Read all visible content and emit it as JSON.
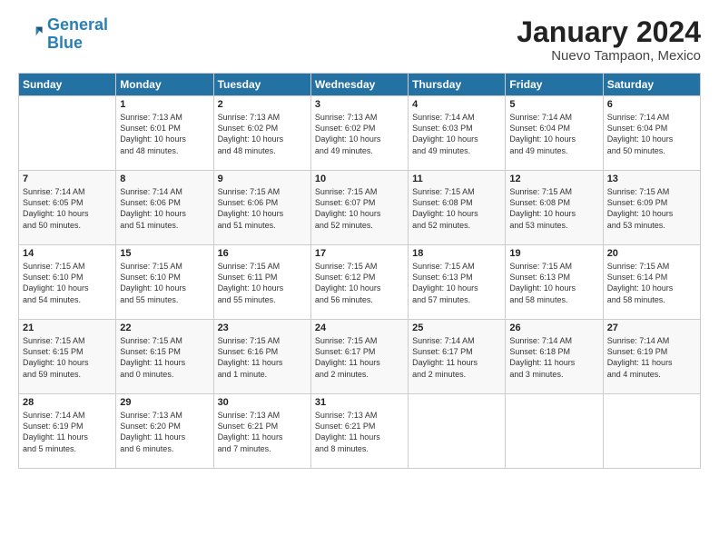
{
  "logo": {
    "line1": "General",
    "line2": "Blue"
  },
  "title": "January 2024",
  "subtitle": "Nuevo Tampaon, Mexico",
  "days_header": [
    "Sunday",
    "Monday",
    "Tuesday",
    "Wednesday",
    "Thursday",
    "Friday",
    "Saturday"
  ],
  "weeks": [
    [
      {
        "day": "",
        "content": ""
      },
      {
        "day": "1",
        "content": "Sunrise: 7:13 AM\nSunset: 6:01 PM\nDaylight: 10 hours\nand 48 minutes."
      },
      {
        "day": "2",
        "content": "Sunrise: 7:13 AM\nSunset: 6:02 PM\nDaylight: 10 hours\nand 48 minutes."
      },
      {
        "day": "3",
        "content": "Sunrise: 7:13 AM\nSunset: 6:02 PM\nDaylight: 10 hours\nand 49 minutes."
      },
      {
        "day": "4",
        "content": "Sunrise: 7:14 AM\nSunset: 6:03 PM\nDaylight: 10 hours\nand 49 minutes."
      },
      {
        "day": "5",
        "content": "Sunrise: 7:14 AM\nSunset: 6:04 PM\nDaylight: 10 hours\nand 49 minutes."
      },
      {
        "day": "6",
        "content": "Sunrise: 7:14 AM\nSunset: 6:04 PM\nDaylight: 10 hours\nand 50 minutes."
      }
    ],
    [
      {
        "day": "7",
        "content": "Sunrise: 7:14 AM\nSunset: 6:05 PM\nDaylight: 10 hours\nand 50 minutes."
      },
      {
        "day": "8",
        "content": "Sunrise: 7:14 AM\nSunset: 6:06 PM\nDaylight: 10 hours\nand 51 minutes."
      },
      {
        "day": "9",
        "content": "Sunrise: 7:15 AM\nSunset: 6:06 PM\nDaylight: 10 hours\nand 51 minutes."
      },
      {
        "day": "10",
        "content": "Sunrise: 7:15 AM\nSunset: 6:07 PM\nDaylight: 10 hours\nand 52 minutes."
      },
      {
        "day": "11",
        "content": "Sunrise: 7:15 AM\nSunset: 6:08 PM\nDaylight: 10 hours\nand 52 minutes."
      },
      {
        "day": "12",
        "content": "Sunrise: 7:15 AM\nSunset: 6:08 PM\nDaylight: 10 hours\nand 53 minutes."
      },
      {
        "day": "13",
        "content": "Sunrise: 7:15 AM\nSunset: 6:09 PM\nDaylight: 10 hours\nand 53 minutes."
      }
    ],
    [
      {
        "day": "14",
        "content": "Sunrise: 7:15 AM\nSunset: 6:10 PM\nDaylight: 10 hours\nand 54 minutes."
      },
      {
        "day": "15",
        "content": "Sunrise: 7:15 AM\nSunset: 6:10 PM\nDaylight: 10 hours\nand 55 minutes."
      },
      {
        "day": "16",
        "content": "Sunrise: 7:15 AM\nSunset: 6:11 PM\nDaylight: 10 hours\nand 55 minutes."
      },
      {
        "day": "17",
        "content": "Sunrise: 7:15 AM\nSunset: 6:12 PM\nDaylight: 10 hours\nand 56 minutes."
      },
      {
        "day": "18",
        "content": "Sunrise: 7:15 AM\nSunset: 6:13 PM\nDaylight: 10 hours\nand 57 minutes."
      },
      {
        "day": "19",
        "content": "Sunrise: 7:15 AM\nSunset: 6:13 PM\nDaylight: 10 hours\nand 58 minutes."
      },
      {
        "day": "20",
        "content": "Sunrise: 7:15 AM\nSunset: 6:14 PM\nDaylight: 10 hours\nand 58 minutes."
      }
    ],
    [
      {
        "day": "21",
        "content": "Sunrise: 7:15 AM\nSunset: 6:15 PM\nDaylight: 10 hours\nand 59 minutes."
      },
      {
        "day": "22",
        "content": "Sunrise: 7:15 AM\nSunset: 6:15 PM\nDaylight: 11 hours\nand 0 minutes."
      },
      {
        "day": "23",
        "content": "Sunrise: 7:15 AM\nSunset: 6:16 PM\nDaylight: 11 hours\nand 1 minute."
      },
      {
        "day": "24",
        "content": "Sunrise: 7:15 AM\nSunset: 6:17 PM\nDaylight: 11 hours\nand 2 minutes."
      },
      {
        "day": "25",
        "content": "Sunrise: 7:14 AM\nSunset: 6:17 PM\nDaylight: 11 hours\nand 2 minutes."
      },
      {
        "day": "26",
        "content": "Sunrise: 7:14 AM\nSunset: 6:18 PM\nDaylight: 11 hours\nand 3 minutes."
      },
      {
        "day": "27",
        "content": "Sunrise: 7:14 AM\nSunset: 6:19 PM\nDaylight: 11 hours\nand 4 minutes."
      }
    ],
    [
      {
        "day": "28",
        "content": "Sunrise: 7:14 AM\nSunset: 6:19 PM\nDaylight: 11 hours\nand 5 minutes."
      },
      {
        "day": "29",
        "content": "Sunrise: 7:13 AM\nSunset: 6:20 PM\nDaylight: 11 hours\nand 6 minutes."
      },
      {
        "day": "30",
        "content": "Sunrise: 7:13 AM\nSunset: 6:21 PM\nDaylight: 11 hours\nand 7 minutes."
      },
      {
        "day": "31",
        "content": "Sunrise: 7:13 AM\nSunset: 6:21 PM\nDaylight: 11 hours\nand 8 minutes."
      },
      {
        "day": "",
        "content": ""
      },
      {
        "day": "",
        "content": ""
      },
      {
        "day": "",
        "content": ""
      }
    ]
  ]
}
